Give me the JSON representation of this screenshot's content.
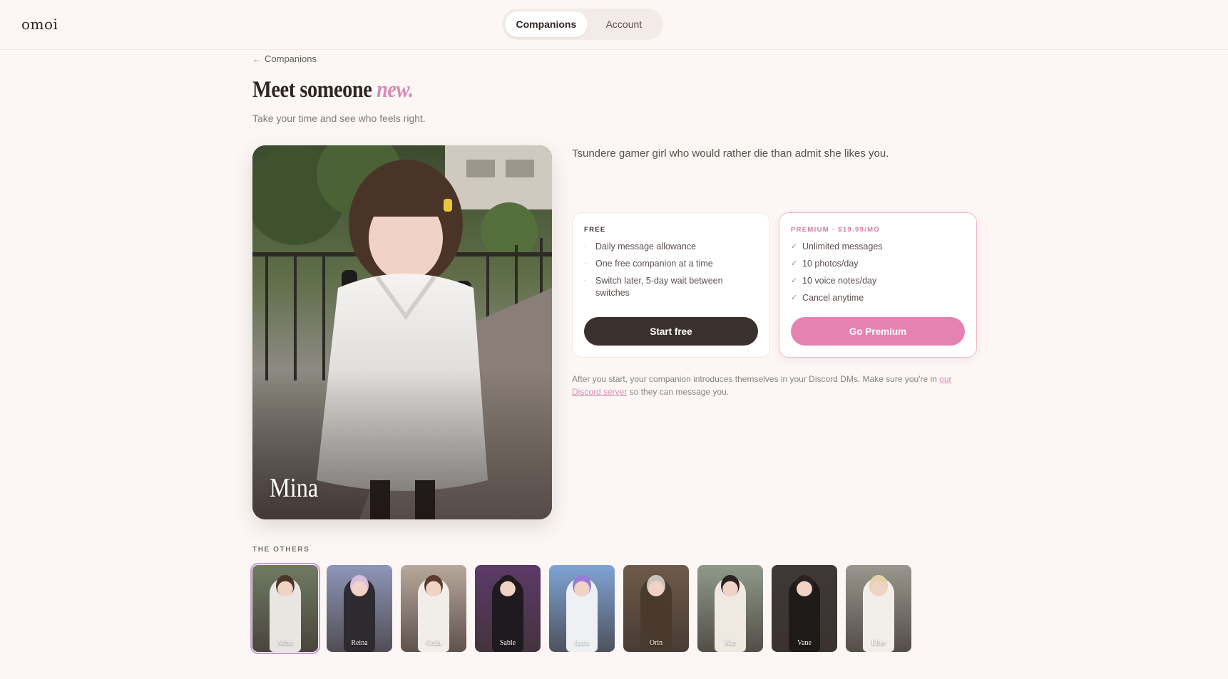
{
  "header": {
    "logo": "omoi",
    "tabs": [
      {
        "label": "Companions",
        "active": true
      },
      {
        "label": "Account",
        "active": false
      }
    ]
  },
  "back_link": {
    "label": "Companions",
    "icon": "arrow-left-icon"
  },
  "headline": {
    "main": "Meet someone ",
    "accent": "new."
  },
  "subhead": "Take your time and see who feels right.",
  "companion": {
    "name": "Mina",
    "description": "Tsundere gamer girl who would rather die than admit she likes you."
  },
  "plans": {
    "free": {
      "title": "FREE",
      "features": [
        "Daily message allowance",
        "One free companion at a time",
        "Switch later, 5-day wait between switches"
      ],
      "button": "Start free"
    },
    "premium": {
      "title": "PREMIUM · $19.99/MO",
      "features": [
        "Unlimited messages",
        "10 photos/day",
        "10 voice notes/day",
        "Cancel anytime"
      ],
      "button": "Go Premium"
    }
  },
  "footnote": {
    "before": "After you start, your companion introduces themselves in your Discord DMs. Make sure you're in ",
    "link": "our Discord server",
    "after": " so they can message you."
  },
  "others": {
    "label": "THE OTHERS",
    "items": [
      {
        "name": "Mina",
        "selected": true,
        "bg": "#6f7a63",
        "body": "#e9e6e2",
        "hair": "#4a3428"
      },
      {
        "name": "Reina",
        "selected": false,
        "bg": "#8d97b8",
        "body": "#2d2a30",
        "hair": "#d8bde0"
      },
      {
        "name": "Celia",
        "selected": false,
        "bg": "#b8a89c",
        "body": "#f1ede9",
        "hair": "#5a3c2e"
      },
      {
        "name": "Sable",
        "selected": false,
        "bg": "#5c3a68",
        "body": "#1e1a20",
        "hair": "#1f1a1c"
      },
      {
        "name": "Luca",
        "selected": false,
        "bg": "#7fa4d6",
        "body": "#eef0f4",
        "hair": "#9a7bd8"
      },
      {
        "name": "Orin",
        "selected": false,
        "bg": "#6e5a48",
        "body": "#4a3a2e",
        "hair": "#c9c4bc"
      },
      {
        "name": "Kin",
        "selected": false,
        "bg": "#8f9a8a",
        "body": "#efe9e2",
        "hair": "#2a221f"
      },
      {
        "name": "Vane",
        "selected": false,
        "bg": "#3e3836",
        "body": "#1d1a19",
        "hair": "#2a2220"
      },
      {
        "name": "Elise",
        "selected": false,
        "bg": "#9a958e",
        "body": "#f2efea",
        "hair": "#e6d3a8"
      }
    ]
  },
  "colors": {
    "accent": "#d98ab5",
    "premium_button": "#e483b2",
    "dark_button": "#3a302d",
    "background": "#fcf7f5"
  }
}
